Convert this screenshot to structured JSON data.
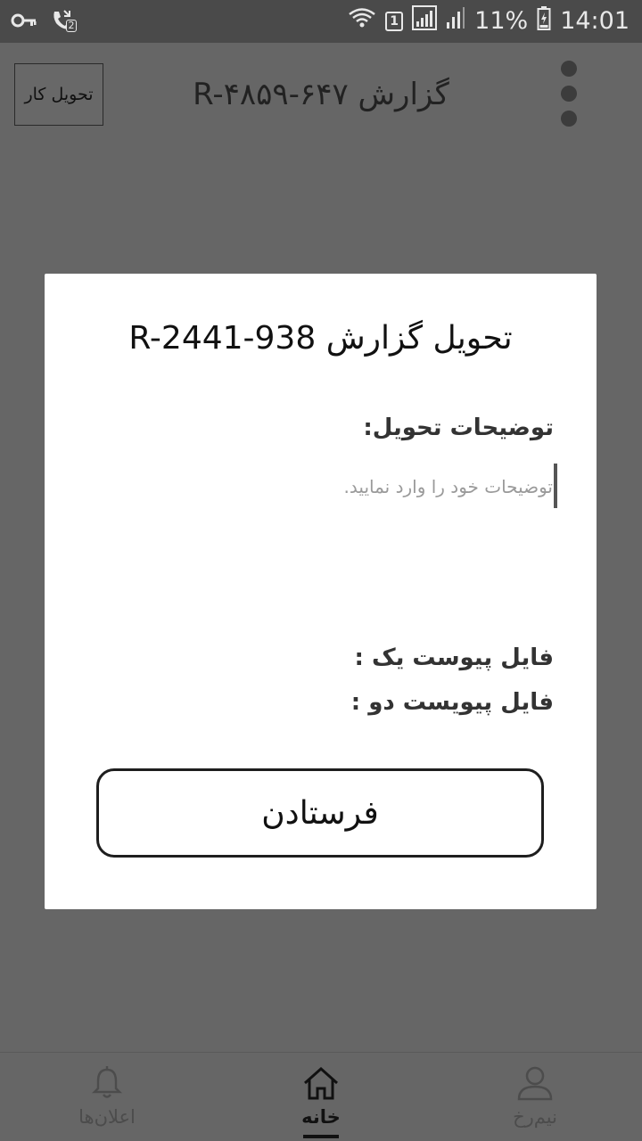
{
  "status_bar": {
    "battery_percent": "11%",
    "time": "14:01",
    "sim_badge": "1",
    "missed_call_badge": "2",
    "icons": [
      "key-icon",
      "missed-call-icon",
      "wifi-icon",
      "sim-icon",
      "signal-icon",
      "signal-icon-2",
      "battery-icon"
    ]
  },
  "header": {
    "deliver_button_label": "تحویل کار",
    "report_title": "گزارش R-۴۸۵۹-۶۴۷",
    "menu_icon": "kebab-menu-icon"
  },
  "dialog": {
    "title": "تحویل گزارش R-2441-938",
    "description_label": "توضیحات تحویل:",
    "description_placeholder": "توضیحات خود را وارد نمایید.",
    "description_value": "",
    "attachment_one_label": "فایل پیوست یک :",
    "attachment_two_label": "فایل پیویست دو :",
    "send_button_label": "فرستادن"
  },
  "bottom_nav": {
    "items": [
      {
        "label": "اعلان‌ها",
        "icon": "bell-icon",
        "active": false
      },
      {
        "label": "خانه",
        "icon": "home-icon",
        "active": true
      },
      {
        "label": "نیم‌رخ",
        "icon": "person-icon",
        "active": false
      }
    ]
  },
  "colors": {
    "overlay_background": "#666666",
    "status_bar": "#4a4a4a",
    "dialog_background": "#ffffff",
    "text_primary": "#111111"
  }
}
